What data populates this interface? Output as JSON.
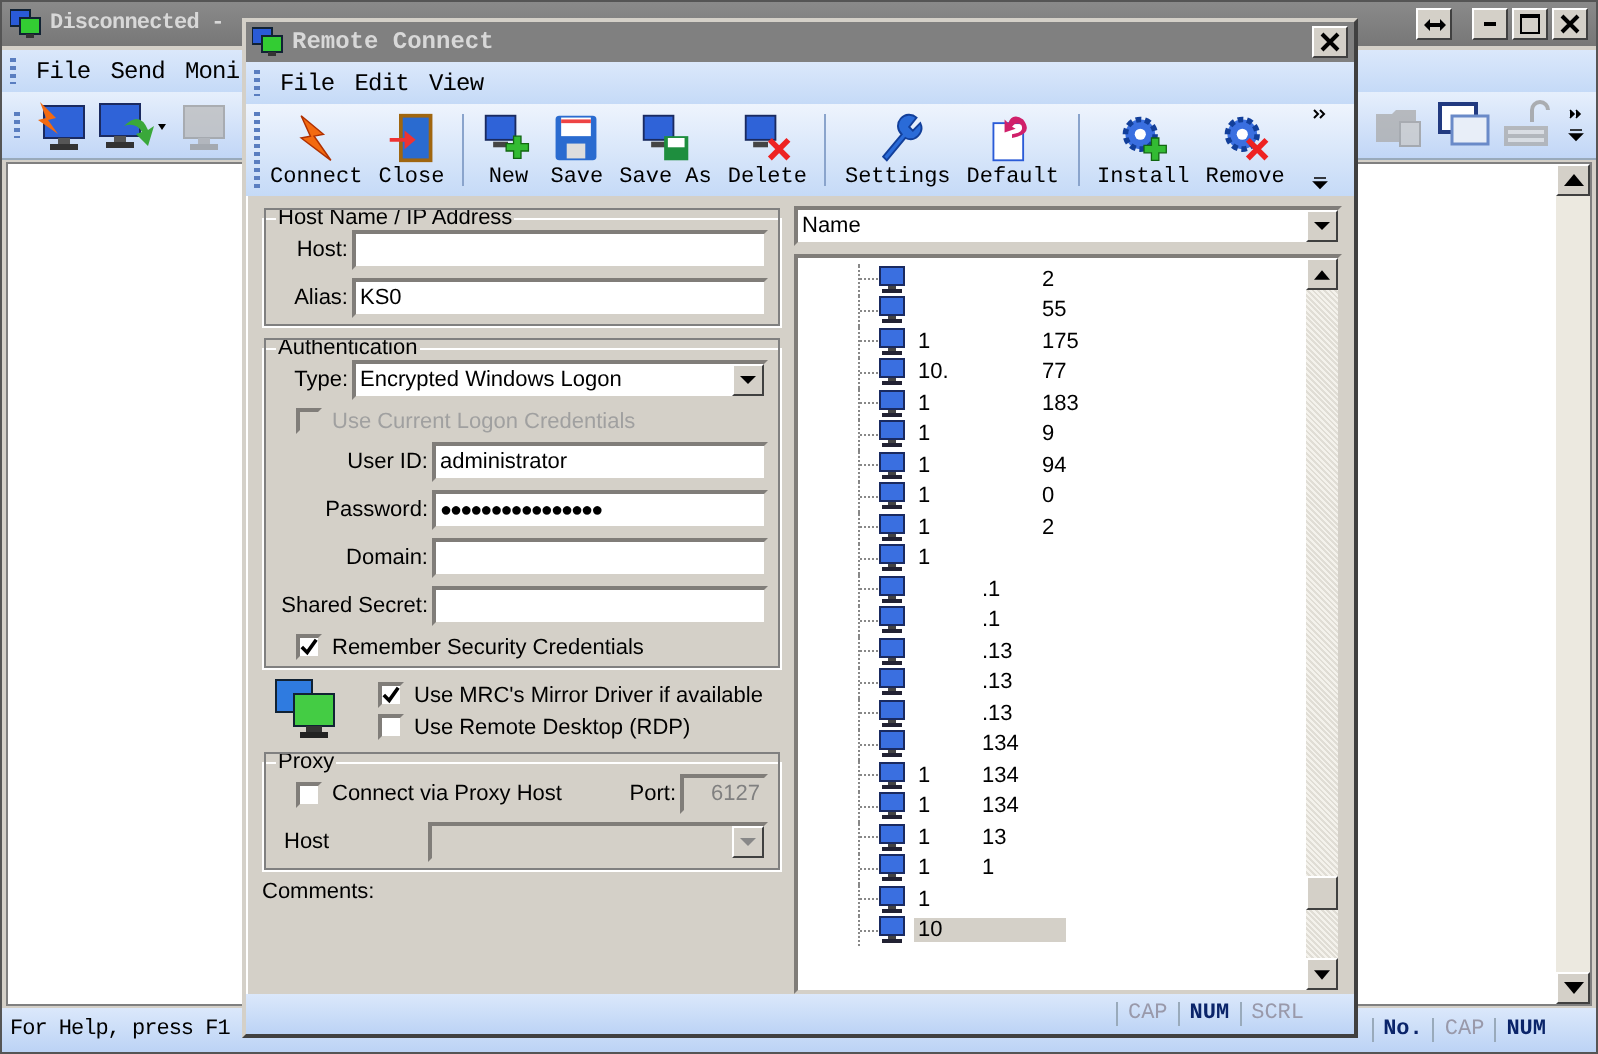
{
  "main_window": {
    "title": "Disconnected -",
    "menu": [
      "File",
      "Send",
      "Moni"
    ],
    "toolbar_left": [
      {
        "kind": "bolt-monitor",
        "disabled": false
      },
      {
        "kind": "monitor-arrow",
        "disabled": false
      },
      {
        "kind": "monitor",
        "disabled": true
      }
    ],
    "toolbar_right": [
      {
        "kind": "folder-monitor",
        "disabled": true
      },
      {
        "kind": "windows",
        "disabled": false
      },
      {
        "kind": "lock-keyboard",
        "disabled": true
      }
    ],
    "status": {
      "help": "For Help, press F1",
      "indicators": [
        {
          "text": "No.",
          "on": true
        },
        {
          "text": "CAP",
          "on": false
        },
        {
          "text": "NUM",
          "on": true
        }
      ]
    }
  },
  "dialog": {
    "title": "Remote Connect",
    "menu": [
      "File",
      "Edit",
      "View"
    ],
    "toolbar": [
      [
        {
          "label": "Connect",
          "kind": "bolt"
        },
        {
          "label": "Close",
          "kind": "door"
        }
      ],
      [
        {
          "label": "New",
          "kind": "monitor-plus"
        },
        {
          "label": "Save",
          "kind": "floppy"
        },
        {
          "label": "Save As",
          "kind": "monitor-floppy"
        },
        {
          "label": "Delete",
          "kind": "monitor-x"
        }
      ],
      [
        {
          "label": "Settings",
          "kind": "wrench"
        },
        {
          "label": "Default",
          "kind": "page-undo"
        }
      ],
      [
        {
          "label": "Install",
          "kind": "gear-plus"
        },
        {
          "label": "Remove",
          "kind": "gear-x"
        }
      ]
    ],
    "host_group": {
      "title": "Host Name / IP Address",
      "host_label": "Host:",
      "alias_label": "Alias:",
      "alias": "KS0"
    },
    "auth_group": {
      "title": "Authentication",
      "type_label": "Type:",
      "type": "Encrypted Windows Logon",
      "use_current": {
        "label": "Use Current Logon Credentials",
        "checked": false,
        "disabled": true
      },
      "user_label": "User ID:",
      "user": "administrator",
      "password_label": "Password:",
      "password": "●●●●●●●●●●●●●●●●",
      "domain_label": "Domain:",
      "secret_label": "Shared Secret:",
      "remember": {
        "label": "Remember Security Credentials",
        "checked": true,
        "disabled": false
      }
    },
    "drivers": [
      {
        "label": "Use MRC's Mirror Driver if available",
        "checked": true
      },
      {
        "label": "Use Remote Desktop (RDP)",
        "checked": false
      }
    ],
    "proxy_group": {
      "title": "Proxy",
      "connect": {
        "label": "Connect via Proxy Host",
        "checked": false
      },
      "port_label": "Port:",
      "port": "6127",
      "host_label": "Host"
    },
    "comments_label": "Comments:",
    "tree": {
      "sort": "Name",
      "items": [
        {
          "end": "2",
          "selected": false
        },
        {
          "end": "55",
          "selected": false
        },
        {
          "start": "1",
          "end": "175",
          "selected": false
        },
        {
          "start": "10.",
          "end": "77",
          "selected": false
        },
        {
          "start": "1",
          "end": "183",
          "selected": false
        },
        {
          "start": "1",
          "end": "9",
          "selected": false
        },
        {
          "start": "1",
          "end": "94",
          "selected": false
        },
        {
          "start": "1",
          "end": "0",
          "selected": false
        },
        {
          "start": "1",
          "end": "2",
          "selected": false
        },
        {
          "start": "1",
          "selected": false
        },
        {
          "middle": ".1",
          "selected": false
        },
        {
          "middle": ".1",
          "selected": false
        },
        {
          "middle": ".13",
          "selected": false
        },
        {
          "middle": ".13",
          "selected": false
        },
        {
          "middle": ".13",
          "selected": false
        },
        {
          "middle": "134",
          "selected": false
        },
        {
          "start": "1",
          "middle": "134",
          "selected": false
        },
        {
          "start": "1",
          "middle": "134",
          "selected": false
        },
        {
          "start": "1",
          "middle": "13",
          "selected": false
        },
        {
          "start": "1",
          "middle": "1",
          "selected": false
        },
        {
          "start": "1",
          "selected": false
        },
        {
          "start": "10",
          "selected": true
        }
      ]
    },
    "status": [
      {
        "text": "CAP",
        "on": false
      },
      {
        "text": "NUM",
        "on": true
      },
      {
        "text": "SCRL",
        "on": false
      }
    ]
  }
}
